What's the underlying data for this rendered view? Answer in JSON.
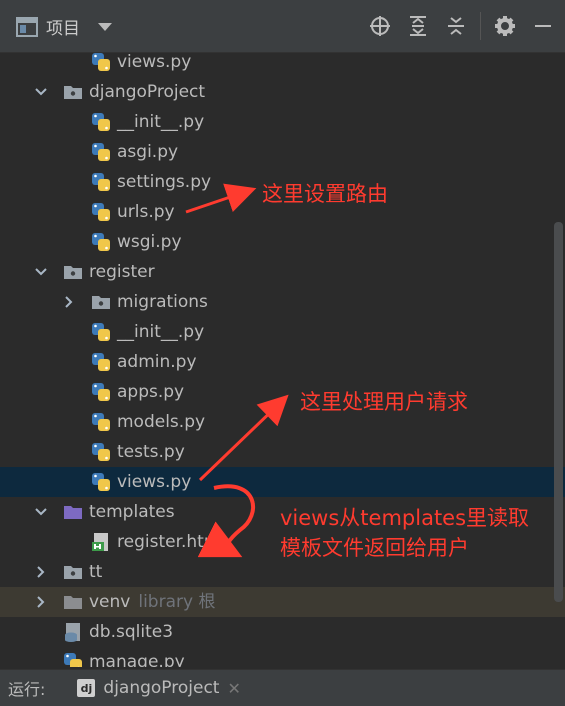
{
  "toolbar": {
    "project_label": "项目"
  },
  "tree": [
    {
      "label": "views.py",
      "type": "py",
      "depth": 2,
      "arrow": "none"
    },
    {
      "label": "djangoProject",
      "type": "folder",
      "depth": 1,
      "arrow": "down"
    },
    {
      "label": "__init__.py",
      "type": "py",
      "depth": 2,
      "arrow": "none"
    },
    {
      "label": "asgi.py",
      "type": "py",
      "depth": 2,
      "arrow": "none"
    },
    {
      "label": "settings.py",
      "type": "py",
      "depth": 2,
      "arrow": "none"
    },
    {
      "label": "urls.py",
      "type": "py",
      "depth": 2,
      "arrow": "none"
    },
    {
      "label": "wsgi.py",
      "type": "py",
      "depth": 2,
      "arrow": "none"
    },
    {
      "label": "register",
      "type": "folder",
      "depth": 1,
      "arrow": "down"
    },
    {
      "label": "migrations",
      "type": "folder",
      "depth": 2,
      "arrow": "right"
    },
    {
      "label": "__init__.py",
      "type": "py",
      "depth": 2,
      "arrow": "none"
    },
    {
      "label": "admin.py",
      "type": "py",
      "depth": 2,
      "arrow": "none"
    },
    {
      "label": "apps.py",
      "type": "py",
      "depth": 2,
      "arrow": "none"
    },
    {
      "label": "models.py",
      "type": "py",
      "depth": 2,
      "arrow": "none"
    },
    {
      "label": "tests.py",
      "type": "py",
      "depth": 2,
      "arrow": "none"
    },
    {
      "label": "views.py",
      "type": "py",
      "depth": 2,
      "arrow": "none",
      "selected": true
    },
    {
      "label": "templates",
      "type": "folder-purple",
      "depth": 1,
      "arrow": "down"
    },
    {
      "label": "register.html",
      "type": "html",
      "depth": 2,
      "arrow": "none"
    },
    {
      "label": "tt",
      "type": "folder",
      "depth": 1,
      "arrow": "right"
    },
    {
      "label": "venv",
      "suffix": "library 根",
      "type": "folder-gray",
      "depth": 1,
      "arrow": "right",
      "excluded": true
    },
    {
      "label": "db.sqlite3",
      "type": "db",
      "depth": 1,
      "arrow": "none"
    },
    {
      "label": "manage.py",
      "type": "py",
      "depth": 1,
      "arrow": "none"
    }
  ],
  "annotations": {
    "urls_note": "这里设置路由",
    "views_note": "这里处理用户请求",
    "templates_note_line1": "views从templates里读取",
    "templates_note_line2": "模板文件返回给用户"
  },
  "status": {
    "run_label": "运行:",
    "run_badge": "dj",
    "run_config": "djangoProject",
    "close_glyph": "✕"
  },
  "colors": {
    "background": "#2b2b2b",
    "selection": "#0d293e",
    "annotation": "#ff3b2f",
    "excluded_row": "#3d3a32"
  }
}
